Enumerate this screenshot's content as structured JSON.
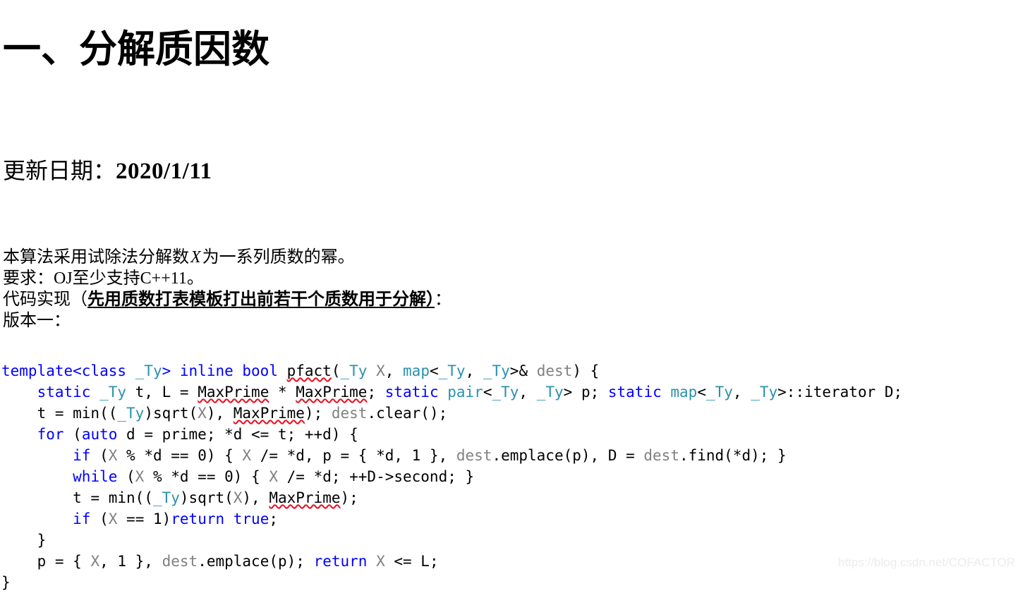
{
  "document": {
    "title": "一、分解质因数",
    "update": {
      "label": "更新日期：",
      "date": "2020/1/11"
    },
    "paragraphs": [
      {
        "id": "algo-description",
        "before_var": "本算法采用试除法分解数",
        "variable": "X",
        "after_var": "为一系列质数的幂。"
      },
      {
        "id": "requirement",
        "prefix": "要求：",
        "latin": "OJ",
        "middle": "至少支持",
        "latin2": "C++11",
        "suffix": "。"
      },
      {
        "id": "code-implementation",
        "prefix": "代码实现（",
        "emphasis": "先用质数打表模板打出前若干个质数用于分解）",
        "suffix": "："
      },
      {
        "id": "version",
        "text": "版本一："
      }
    ]
  },
  "code": {
    "language": "cpp",
    "colors": {
      "keyword": "#0000ff",
      "type": "#2b91af",
      "variable": "#808080",
      "plain": "#000000",
      "spellcheck_underline": "#e81123"
    },
    "lines": [
      {
        "indent": 0,
        "tokens": [
          {
            "t": "template<class ",
            "c": "kw"
          },
          {
            "t": "_Ty",
            "c": "typ"
          },
          {
            "t": "> ",
            "c": "kw"
          },
          {
            "t": "inline bool ",
            "c": "kw"
          },
          {
            "t": "pfact",
            "c": "pln",
            "squiggly": true
          },
          {
            "t": "(",
            "c": "pln"
          },
          {
            "t": "_Ty",
            "c": "typ"
          },
          {
            "t": " ",
            "c": "pln"
          },
          {
            "t": "X",
            "c": "var"
          },
          {
            "t": ", ",
            "c": "pln"
          },
          {
            "t": "map",
            "c": "typ"
          },
          {
            "t": "<",
            "c": "pln"
          },
          {
            "t": "_Ty",
            "c": "typ"
          },
          {
            "t": ", ",
            "c": "pln"
          },
          {
            "t": "_Ty",
            "c": "typ"
          },
          {
            "t": ">& ",
            "c": "pln"
          },
          {
            "t": "dest",
            "c": "var"
          },
          {
            "t": ") {",
            "c": "pln"
          }
        ]
      },
      {
        "indent": 4,
        "tokens": [
          {
            "t": "static ",
            "c": "kw"
          },
          {
            "t": "_Ty",
            "c": "typ"
          },
          {
            "t": " t, L = ",
            "c": "pln"
          },
          {
            "t": "MaxPrime",
            "c": "pln",
            "squiggly": true
          },
          {
            "t": " * ",
            "c": "pln"
          },
          {
            "t": "MaxPrime",
            "c": "pln",
            "squiggly": true
          },
          {
            "t": "; ",
            "c": "pln"
          },
          {
            "t": "static ",
            "c": "kw"
          },
          {
            "t": "pair",
            "c": "typ"
          },
          {
            "t": "<",
            "c": "pln"
          },
          {
            "t": "_Ty",
            "c": "typ"
          },
          {
            "t": ", ",
            "c": "pln"
          },
          {
            "t": "_Ty",
            "c": "typ"
          },
          {
            "t": "> p; ",
            "c": "pln"
          },
          {
            "t": "static ",
            "c": "kw"
          },
          {
            "t": "map",
            "c": "typ"
          },
          {
            "t": "<",
            "c": "pln"
          },
          {
            "t": "_Ty",
            "c": "typ"
          },
          {
            "t": ", ",
            "c": "pln"
          },
          {
            "t": "_Ty",
            "c": "typ"
          },
          {
            "t": ">::iterator D;",
            "c": "pln"
          }
        ]
      },
      {
        "indent": 4,
        "tokens": [
          {
            "t": "t = min((",
            "c": "pln"
          },
          {
            "t": "_Ty",
            "c": "typ"
          },
          {
            "t": ")sqrt(",
            "c": "pln"
          },
          {
            "t": "X",
            "c": "var"
          },
          {
            "t": "), ",
            "c": "pln"
          },
          {
            "t": "MaxPrime",
            "c": "pln",
            "squiggly": true
          },
          {
            "t": "); ",
            "c": "pln"
          },
          {
            "t": "dest",
            "c": "var"
          },
          {
            "t": ".clear();",
            "c": "pln"
          }
        ]
      },
      {
        "indent": 4,
        "tokens": [
          {
            "t": "for ",
            "c": "kw"
          },
          {
            "t": "(",
            "c": "pln"
          },
          {
            "t": "auto",
            "c": "kw"
          },
          {
            "t": " d = prime; *d <= t; ++d) {",
            "c": "pln"
          }
        ]
      },
      {
        "indent": 8,
        "tokens": [
          {
            "t": "if ",
            "c": "kw"
          },
          {
            "t": "(",
            "c": "pln"
          },
          {
            "t": "X",
            "c": "var"
          },
          {
            "t": " % *d == 0) { ",
            "c": "pln"
          },
          {
            "t": "X",
            "c": "var"
          },
          {
            "t": " /= *d, p = { *d, 1 }, ",
            "c": "pln"
          },
          {
            "t": "dest",
            "c": "var"
          },
          {
            "t": ".emplace(p), D = ",
            "c": "pln"
          },
          {
            "t": "dest",
            "c": "var"
          },
          {
            "t": ".find(*d); }",
            "c": "pln"
          }
        ]
      },
      {
        "indent": 8,
        "tokens": [
          {
            "t": "while ",
            "c": "kw"
          },
          {
            "t": "(",
            "c": "pln"
          },
          {
            "t": "X",
            "c": "var"
          },
          {
            "t": " % *d == 0) { ",
            "c": "pln"
          },
          {
            "t": "X",
            "c": "var"
          },
          {
            "t": " /= *d; ++D->second; }",
            "c": "pln"
          }
        ]
      },
      {
        "indent": 8,
        "tokens": [
          {
            "t": "t = min((",
            "c": "pln"
          },
          {
            "t": "_Ty",
            "c": "typ"
          },
          {
            "t": ")sqrt(",
            "c": "pln"
          },
          {
            "t": "X",
            "c": "var"
          },
          {
            "t": "), ",
            "c": "pln"
          },
          {
            "t": "MaxPrime",
            "c": "pln",
            "squiggly": true
          },
          {
            "t": ");",
            "c": "pln"
          }
        ]
      },
      {
        "indent": 8,
        "tokens": [
          {
            "t": "if ",
            "c": "kw"
          },
          {
            "t": "(",
            "c": "pln"
          },
          {
            "t": "X",
            "c": "var"
          },
          {
            "t": " == 1)",
            "c": "pln"
          },
          {
            "t": "return true",
            "c": "kw"
          },
          {
            "t": ";",
            "c": "pln"
          }
        ]
      },
      {
        "indent": 4,
        "tokens": [
          {
            "t": "}",
            "c": "pln"
          }
        ]
      },
      {
        "indent": 4,
        "tokens": [
          {
            "t": "p = { ",
            "c": "pln"
          },
          {
            "t": "X",
            "c": "var"
          },
          {
            "t": ", 1 }, ",
            "c": "pln"
          },
          {
            "t": "dest",
            "c": "var"
          },
          {
            "t": ".emplace(p); ",
            "c": "pln"
          },
          {
            "t": "return ",
            "c": "kw"
          },
          {
            "t": "X",
            "c": "var"
          },
          {
            "t": " <= L;",
            "c": "pln"
          }
        ]
      },
      {
        "indent": 0,
        "tokens": [
          {
            "t": "}",
            "c": "pln"
          }
        ]
      }
    ]
  },
  "watermark": {
    "text": "https://blog.csdn.net/COFACTOR",
    "color": "#ececec"
  }
}
